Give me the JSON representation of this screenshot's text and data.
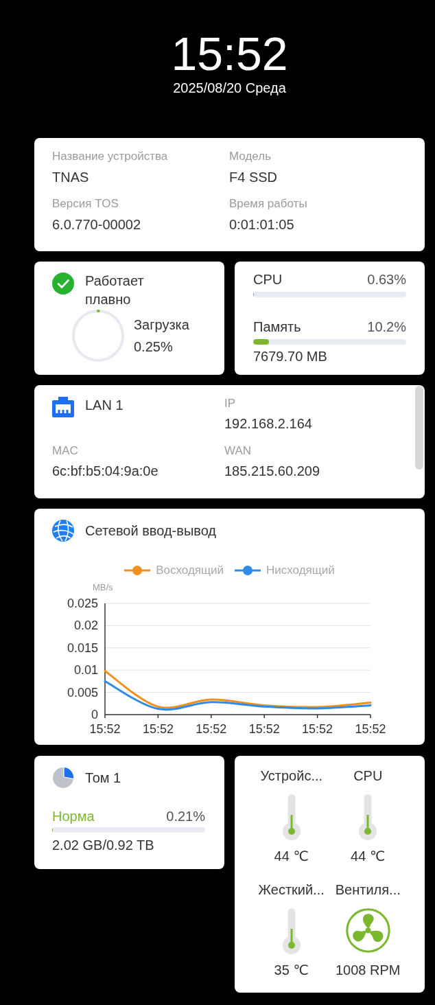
{
  "clock": {
    "time": "15:52",
    "date": "2025/08/20 Среда"
  },
  "device_info": {
    "fields": [
      {
        "label": "Название устройства",
        "value": "TNAS"
      },
      {
        "label": "Модель",
        "value": "F4 SSD"
      },
      {
        "label": "Версия TOS",
        "value": "6.0.770-00002"
      },
      {
        "label": "Время работы",
        "value": "0:01:01:05"
      }
    ]
  },
  "system_status": {
    "text": "Работает плавно",
    "load_label": "Загрузка",
    "load_value": "0.25%",
    "level": 0.0025
  },
  "resources": [
    {
      "name": "CPU",
      "value": "0.63%",
      "level": 0.0063
    },
    {
      "name": "Память",
      "value": "10.2%",
      "level": 0.102,
      "detail": "7679.70 MB"
    }
  ],
  "network": {
    "interface": "LAN 1",
    "fields": [
      {
        "label": "IP",
        "value": "192.168.2.164"
      },
      {
        "label": "MAC",
        "value": "6c:bf:b5:04:9a:0e"
      },
      {
        "label": "WAN",
        "value": "185.215.60.209"
      }
    ]
  },
  "network_io": {
    "title": "Сетевой ввод-вывод",
    "chart_data": {
      "type": "line",
      "ylabel": "MB/s",
      "categories": [
        "15:52",
        "15:52",
        "15:52",
        "15:52",
        "15:52",
        "15:52"
      ],
      "series": [
        {
          "name": "Восходящий",
          "color": "#f0901e",
          "values": [
            0.0098,
            0.0018,
            0.0034,
            0.0021,
            0.0017,
            0.0027
          ]
        },
        {
          "name": "Нисходящий",
          "color": "#2f8be8",
          "values": [
            0.0075,
            0.0013,
            0.0028,
            0.0018,
            0.0014,
            0.0021
          ]
        }
      ],
      "ylim": [
        0,
        0.025
      ],
      "yticks": [
        0,
        0.005,
        0.01,
        0.015,
        0.02,
        0.025
      ],
      "grid": true,
      "legend": true
    }
  },
  "volume": {
    "name": "Том 1",
    "status": "Норма",
    "usage": "0.21%",
    "level": 0.0021,
    "capacity": "2.02 GB/0.92 TB"
  },
  "sensors": [
    {
      "kind": "thermometer",
      "name": "Устройс...",
      "reading": "44 ℃"
    },
    {
      "kind": "thermometer",
      "name": "CPU",
      "reading": "44 ℃"
    },
    {
      "kind": "thermometer",
      "name": "Жесткий...",
      "reading": "35 ℃"
    },
    {
      "kind": "fan",
      "name": "Вентиля...",
      "reading": "1008 RPM"
    }
  ]
}
